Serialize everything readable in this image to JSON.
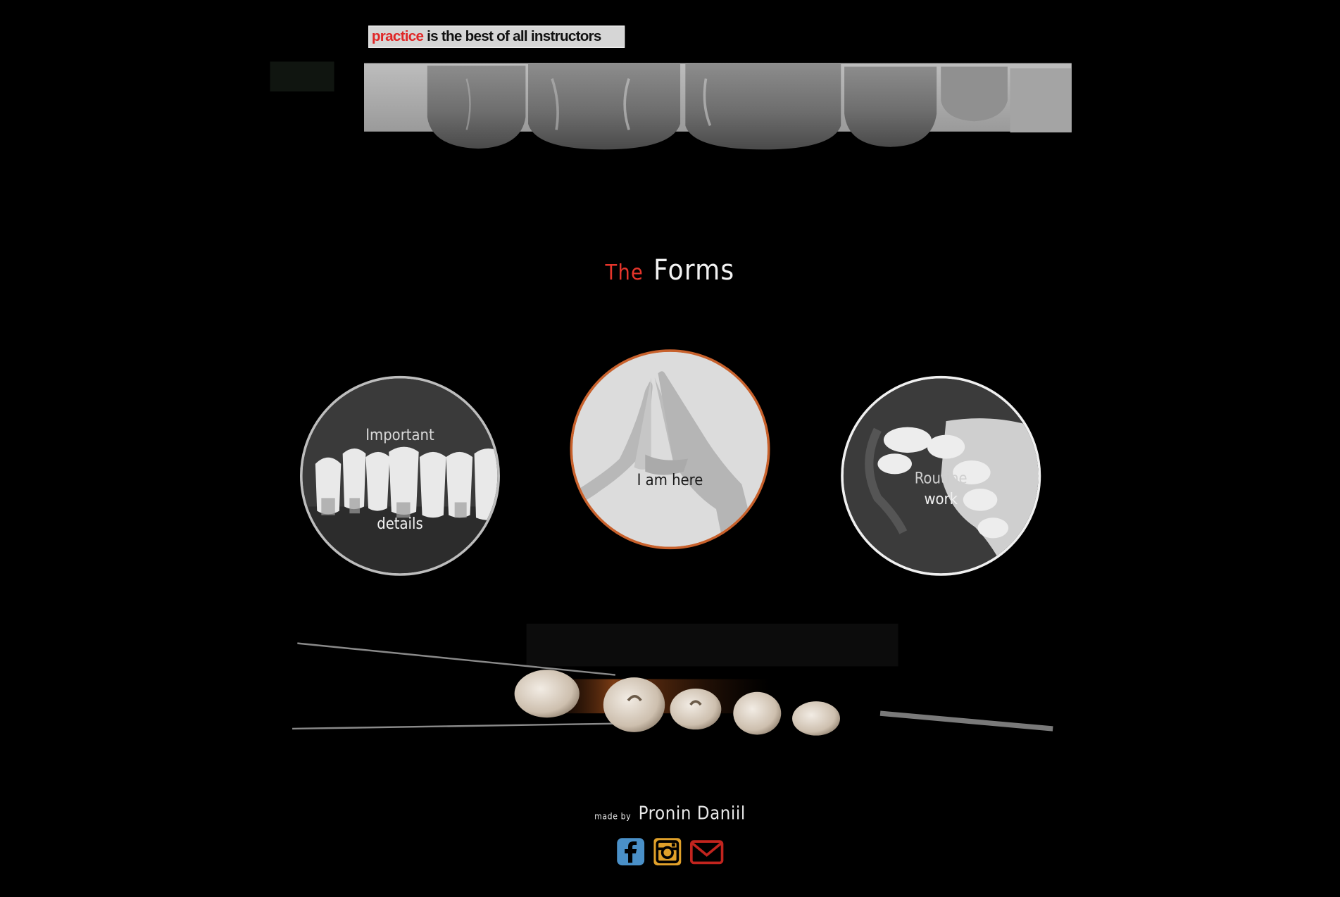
{
  "header": {
    "motto_highlight": "practice",
    "motto_rest": "is the best of all instructors"
  },
  "section": {
    "title_prefix": "The",
    "title_main": "Forms"
  },
  "circles": [
    {
      "top_text": "Important",
      "bottom_text": "details"
    },
    {
      "text": "I am here"
    },
    {
      "line1": "Routine",
      "line2": "work"
    }
  ],
  "footer": {
    "made_by_label": "made by",
    "author": "Pronin Daniil"
  },
  "social": {
    "facebook_icon": "facebook-icon",
    "instagram_icon": "instagram-icon",
    "email_icon": "email-icon",
    "colors": {
      "facebook": "#4a90c8",
      "instagram": "#e0a02a",
      "email": "#c2241e"
    }
  },
  "colors": {
    "background": "#000000",
    "accent_red": "#e6352b",
    "circle_orange_border": "#c8612c"
  }
}
